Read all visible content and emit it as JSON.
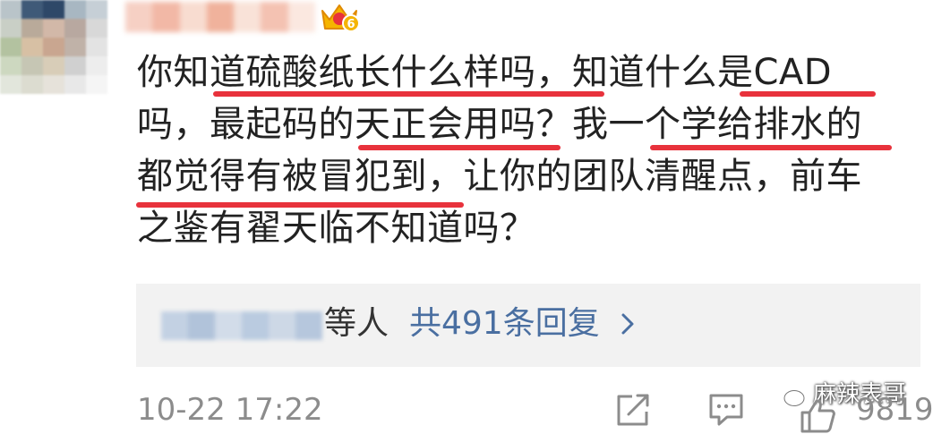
{
  "comment": {
    "lines": [
      "你知道硫酸纸长什么样吗，知道什么是CAD",
      "吗，最起码的天正会用吗？我一个学给排水的",
      "都觉得有被冒犯到，让你的团队清醒点，前车",
      "之鉴有翟天临不知道吗？"
    ]
  },
  "replies": {
    "suffix": "等人",
    "count_label": "共491条回复"
  },
  "footer": {
    "timestamp": "10-22 17:22",
    "like_count": "9819"
  },
  "watermark": {
    "text": "麻辣表哥"
  },
  "icons": {
    "vip": "crown-badge-icon",
    "share": "share-icon",
    "comment": "comment-icon",
    "like": "thumb-up-icon",
    "chevron": "chevron-right-icon",
    "watermark": "wechat-icon"
  },
  "colors": {
    "text": "#222222",
    "muted": "#8c8c8c",
    "link": "#4a6fa1",
    "annotation": "#e8323c",
    "reply_bg": "#f2f2f2"
  }
}
